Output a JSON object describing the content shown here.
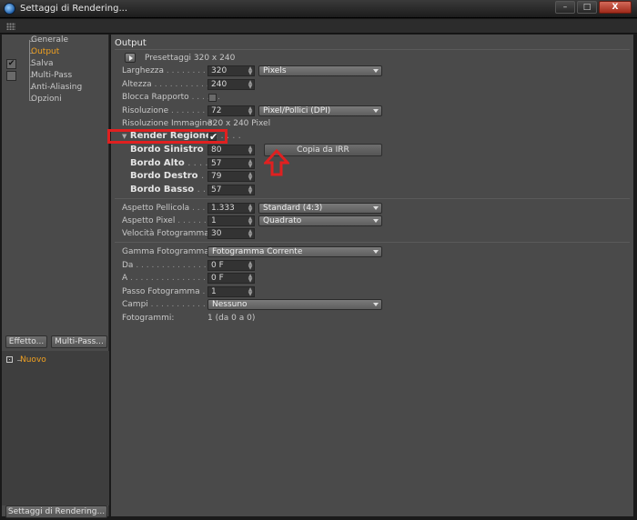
{
  "window": {
    "title": "Settaggi di Rendering...",
    "buttons": {
      "minimize": "–",
      "maximize": "□",
      "close": "X"
    }
  },
  "sidebar": {
    "items": [
      {
        "label": "Generale",
        "active": false,
        "checked": false
      },
      {
        "label": "Output",
        "active": true,
        "checked": false
      },
      {
        "label": "Salva",
        "active": false,
        "checked": true
      },
      {
        "label": "Multi-Pass",
        "active": false,
        "checked": false
      },
      {
        "label": "Anti-Aliasing",
        "active": false,
        "checked": false
      },
      {
        "label": "Opzioni",
        "active": false,
        "checked": false
      }
    ],
    "effect_button": "Effetto...",
    "multipass_button": "Multi-Pass...",
    "effect_item": "Nuovo",
    "settings_button": "Settaggi di Rendering..."
  },
  "output": {
    "section_title": "Output",
    "preset_label": "Presettaggi 320 x 240",
    "width": {
      "label": "Larghezza",
      "value": "320",
      "unit": "Pixels"
    },
    "height": {
      "label": "Altezza",
      "value": "240"
    },
    "lock_ratio": {
      "label": "Blocca Rapporto"
    },
    "resolution": {
      "label": "Risoluzione",
      "value": "72",
      "unit": "Pixel/Pollici (DPI)"
    },
    "image_resolution": {
      "label": "Risoluzione Immagine:",
      "value": "320 x 240 Pixel"
    },
    "render_region": {
      "label": "Render Regione",
      "check": "✔"
    },
    "left_border": {
      "label": "Bordo Sinistro",
      "value": "80"
    },
    "top_border": {
      "label": "Bordo Alto",
      "value": "57"
    },
    "right_border": {
      "label": "Bordo Destro",
      "value": "79"
    },
    "bottom_border": {
      "label": "Bordo Basso",
      "value": "57"
    },
    "copy_button": "Copia da IRR",
    "film_aspect": {
      "label": "Aspetto Pellicola",
      "value": "1.333",
      "option": "Standard (4:3)"
    },
    "pixel_aspect": {
      "label": "Aspetto Pixel",
      "value": "1",
      "option": "Quadrato"
    },
    "frame_rate": {
      "label": "Velocità Fotogramma",
      "value": "30"
    },
    "frame_range": {
      "label": "Gamma Fotogramma",
      "option": "Fotogramma Corrente"
    },
    "from": {
      "label": "Da",
      "value": "0 F"
    },
    "to": {
      "label": "A",
      "value": "0 F"
    },
    "frame_step": {
      "label": "Passo Fotogramma",
      "value": "1"
    },
    "fields": {
      "label": "Campi",
      "option": "Nessuno"
    },
    "frames": {
      "label": "Fotogrammi:",
      "value": "1 (da 0 a 0)"
    }
  },
  "colors": {
    "active": "#f0a020",
    "highlight": "#e02020",
    "panel": "#4a4a4a"
  }
}
